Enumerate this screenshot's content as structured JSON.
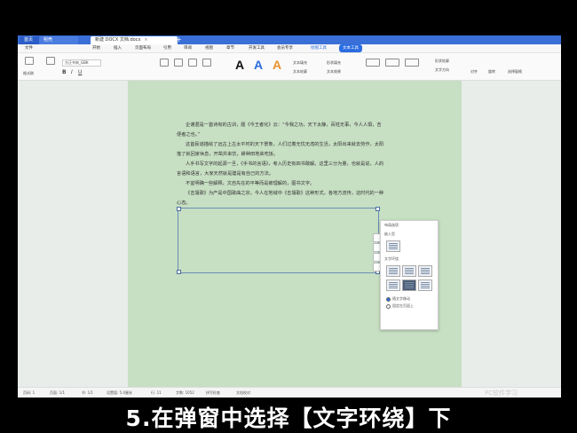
{
  "tabs": {
    "home": "首页",
    "wps": "稻壳",
    "doc": "新建 DOCX 文档.docx",
    "close": "×",
    "plus": "+"
  },
  "menu": {
    "file": "文件",
    "start": "开始",
    "insert": "插入",
    "page": "页面布局",
    "ref": "引用",
    "review": "审阅",
    "view": "视图",
    "chapter": "章节",
    "tools": "开发工具",
    "member": "会员专享",
    "picture_tools": "绘图工具",
    "text_tools": "文本工具"
  },
  "toolbar": {
    "format_painter": "格式刷",
    "font_name": "方正书宋_GBK",
    "shape_fill": "形状填充",
    "shape_outline": "形状轮廓",
    "text_fill": "文本填充",
    "text_outline": "文本轮廓",
    "text_effect": "文本效果",
    "text_direction": "文字方向",
    "align": "对齐",
    "rotate": "旋转",
    "select_pane": "选择窗格"
  },
  "document": {
    "paragraphs": [
      "企谨遐是一首诗有的古训，题《今王者化》云：“今我之功，天下太静，百姓无事，今人人惧，吉便者之也。”",
      "这首民谣描绘了远古上古太平时的天下景象，人们过着无忧无虑的生活，太阳出来就去劳作，太阳落了就回家休息，开凿井来饮，耕种田地来吃饭。",
      "人手书写文字的起源一旦，《手书的言语》，考入历史有四书敢解。这里三分为量，也就是说，人的言语和语言，大家天然就是建是有自己的方法。",
      "不宜明确一些解释，文自先在的平等而是被理解的，图书文字。",
      "《击壤歌》为产是中国歌曲之宗，今人在地域中《击壤歌》这种形式，各地方流传，这时代的一种心态。"
    ]
  },
  "sidepanel": {
    "title": "布局选项",
    "inline": "嵌入型",
    "wrap": "文字环绕",
    "move_with_text": "随文字移动",
    "fix_on_page": "固定在页面上"
  },
  "status": {
    "page": "页码: 1",
    "pages": "页面: 1/1",
    "section": "节: 1/1",
    "row": "设置值: 5.4厘米",
    "col": "行: 11",
    "words": "字数: 1052",
    "spell": "拼写检查",
    "doc_check": "文档校对"
  },
  "caption": "5.在弹窗中选择【文字环绕】下",
  "watermark": "PC软件学习"
}
